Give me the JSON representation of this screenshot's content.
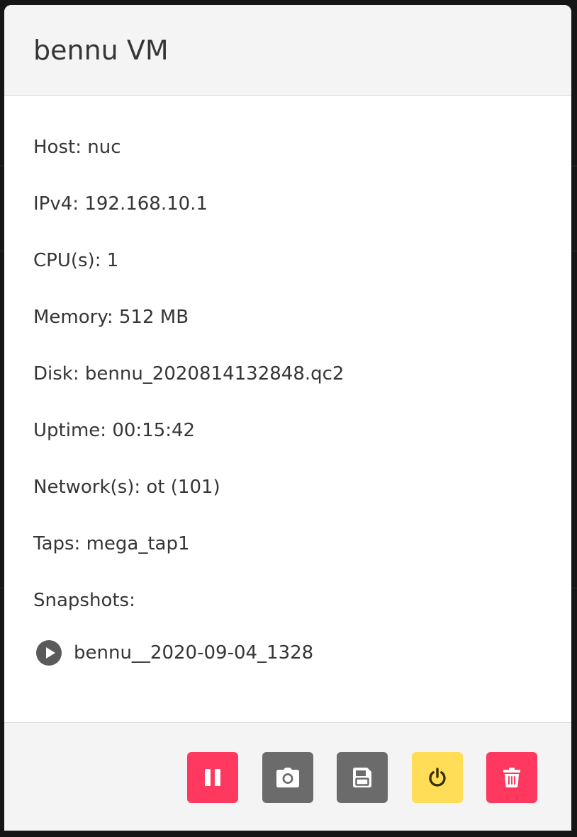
{
  "modal": {
    "title": "bennu VM"
  },
  "details": [
    {
      "label": "Host:",
      "value": "nuc"
    },
    {
      "label": "IPv4:",
      "value": "192.168.10.1"
    },
    {
      "label": "CPU(s):",
      "value": "1"
    },
    {
      "label": "Memory:",
      "value": "512 MB"
    },
    {
      "label": "Disk:",
      "value": "bennu_2020814132848.qc2"
    },
    {
      "label": "Uptime:",
      "value": "00:15:42"
    },
    {
      "label": "Network(s):",
      "value": "ot (101)"
    },
    {
      "label": "Taps:",
      "value": "mega_tap1"
    },
    {
      "label": "Snapshots:",
      "value": ""
    }
  ],
  "snapshots": [
    {
      "name": "bennu__2020-09-04_1328",
      "icon": "play-circle-icon"
    }
  ],
  "footer": {
    "buttons": [
      {
        "name": "pause",
        "icon": "pause-icon",
        "color": "#ff3860"
      },
      {
        "name": "snapshot",
        "icon": "camera-icon",
        "color": "#6b6b6b"
      },
      {
        "name": "save",
        "icon": "floppy-disk-icon",
        "color": "#6b6b6b"
      },
      {
        "name": "power",
        "icon": "power-icon",
        "color": "#ffdd57"
      },
      {
        "name": "delete",
        "icon": "trash-icon",
        "color": "#ff3860"
      }
    ]
  }
}
